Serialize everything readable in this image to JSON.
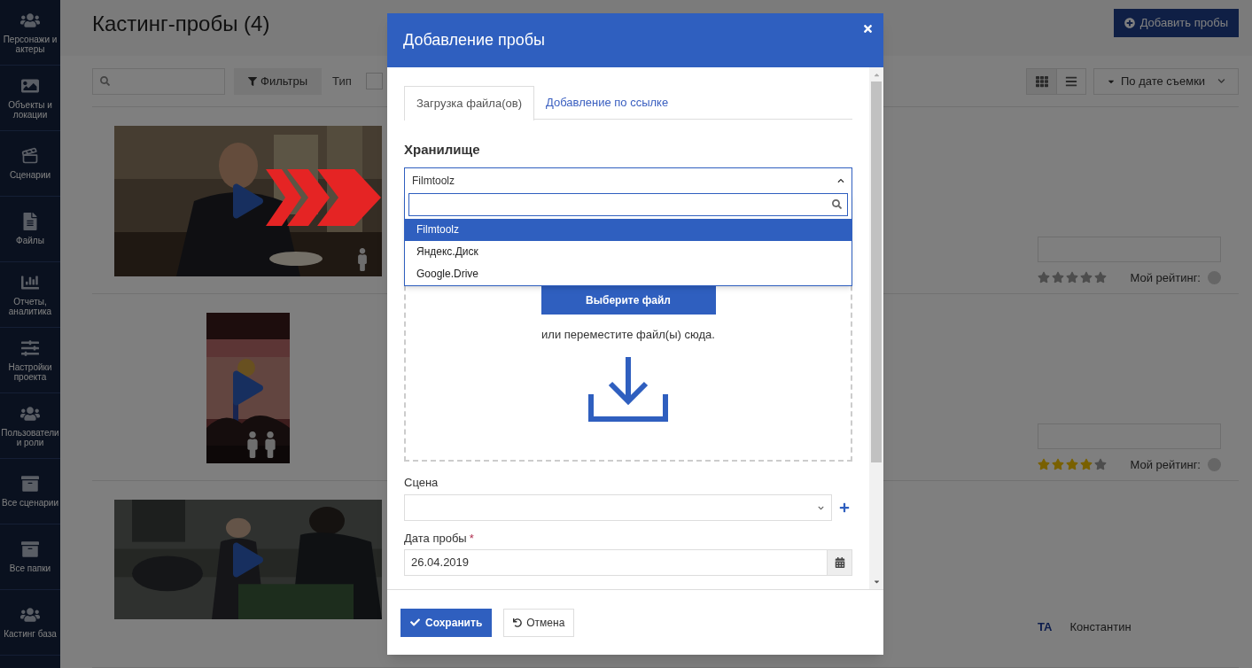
{
  "sidebar": {
    "items": [
      {
        "label": "Персонажи и актеры"
      },
      {
        "label": "Объекты и локации"
      },
      {
        "label": "Сценарии"
      },
      {
        "label": "Файлы"
      },
      {
        "label": "Отчеты, аналитика"
      },
      {
        "label": "Настройки проекта"
      },
      {
        "label": "Пользователи и роли"
      },
      {
        "label": "Все сценарии"
      },
      {
        "label": "Все папки"
      },
      {
        "label": "Кастинг база"
      }
    ]
  },
  "page": {
    "title": "Кастинг-пробы (4)",
    "add_button": "Добавить пробы"
  },
  "toolbar": {
    "filters_button": "Фильтры",
    "type_label": "Тип",
    "type_checked": false,
    "sort": "По дате съемки"
  },
  "cards": [
    {
      "stars": 0,
      "rating_label": "Мой рейтинг:"
    },
    {
      "stars": 4,
      "rating_label": "Мой рейтинг:"
    },
    {
      "author_initials": "ТА",
      "author_name": "Константин"
    }
  ],
  "modal": {
    "title": "Добавление пробы",
    "tabs": [
      {
        "label": "Загрузка файла(ов)",
        "selected": true
      },
      {
        "label": "Добавление по ссылке",
        "selected": false
      }
    ],
    "storage": {
      "label": "Хранилище",
      "value": "Filmtoolz",
      "expanded": true,
      "options": [
        {
          "label": "Filmtoolz",
          "selected": true
        },
        {
          "label": "Яндекс.Диск",
          "selected": false
        },
        {
          "label": "Google.Drive",
          "selected": false
        }
      ]
    },
    "upload": {
      "button": "Выберите файл",
      "hint": "или переместите файл(ы) сюда."
    },
    "scene": {
      "label": "Сцена"
    },
    "date": {
      "label": "Дата пробы",
      "required_mark": "*",
      "value": "26.04.2019"
    },
    "save_button": "Сохранить",
    "cancel_button": "Отмена"
  }
}
